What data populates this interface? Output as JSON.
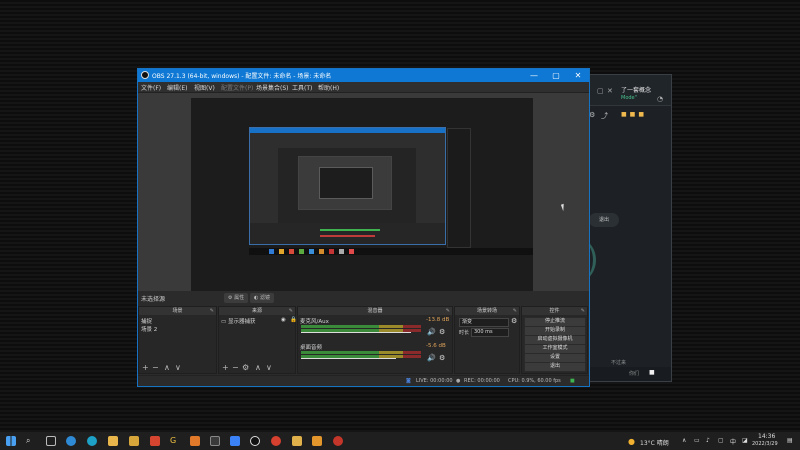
{
  "bg_window": {
    "title_text": "了一套概念",
    "subtitle_text": "Mode\"",
    "exit_label": "退出",
    "bottom_right_label": "不过来",
    "footer_labels": [
      "你们",
      "CPU 活动"
    ]
  },
  "obs": {
    "title": "OBS 27.1.3 (64-bit, windows) - 配置文件: 未命名 - 场景: 未命名",
    "menu": [
      "文件(F)",
      "编辑(E)",
      "视图(V)",
      "配置文件(P)",
      "场景集合(S)",
      "工具(T)",
      "帮助(H)"
    ],
    "toolbar": {
      "no_source": "未选择源",
      "properties": "属性",
      "filters": "滤镜"
    },
    "docks": {
      "scenes": {
        "title": "场景",
        "items": [
          "捕捉",
          "场景 2"
        ]
      },
      "sources": {
        "title": "来源",
        "items": [
          "显示器捕获"
        ]
      },
      "mixer": {
        "title": "混音器",
        "channels": [
          {
            "name": "麦克风/Aux",
            "db": "-13.8 dB"
          },
          {
            "name": "桌面音频",
            "db": "-5.6 dB"
          }
        ]
      },
      "transitions": {
        "title": "场景转场",
        "type": "渐变",
        "duration_label": "时长",
        "duration_value": "300 ms"
      },
      "controls": {
        "title": "控件",
        "buttons": [
          "停止推流",
          "开始录制",
          "启动虚拟摄像机",
          "工作室模式",
          "设置",
          "退出"
        ]
      }
    },
    "status": {
      "live_label": "LIVE: 00:00:00",
      "rec_label": "REC: 00:00:00",
      "cpu_label": "CPU: 0.9%, 60.00 fps"
    }
  },
  "taskbar": {
    "weather": "13°C 晴朗",
    "ime": "中",
    "clock_time": "14:36",
    "clock_date": "2022/3/29"
  }
}
